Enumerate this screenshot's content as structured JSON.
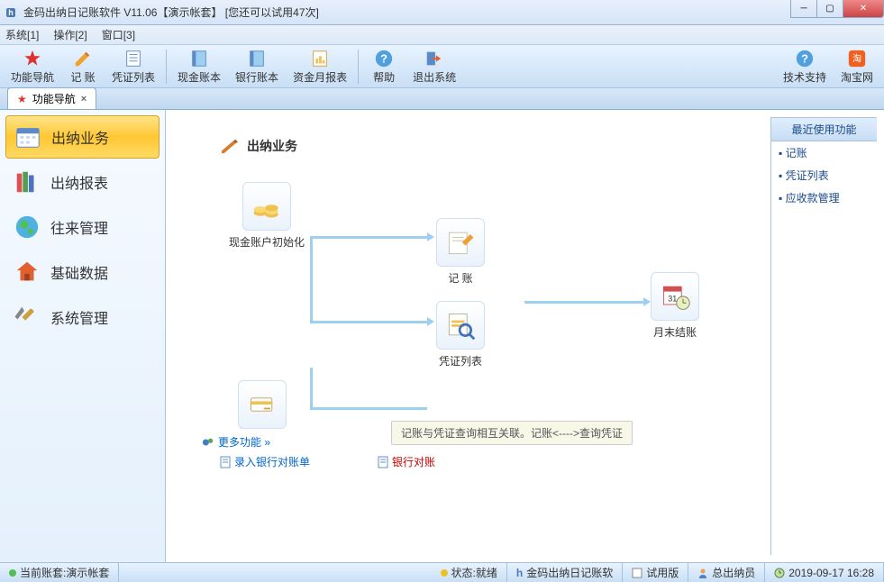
{
  "window": {
    "title": "金码出纳日记账软件  V11.06【演示帐套】  [您还可以试用47次]"
  },
  "menu": {
    "sys": "系统[1]",
    "op": "操作[2]",
    "win": "窗口[3]"
  },
  "toolbar": {
    "nav": "功能导航",
    "entry": "记   账",
    "vouchers": "凭证列表",
    "cashbook": "现金账本",
    "bankbook": "银行账本",
    "monthrep": "资金月报表",
    "help": "帮助",
    "exit": "退出系统",
    "tech": "技术支持",
    "taobao": "淘宝网"
  },
  "tab": {
    "label": "功能导航",
    "icon": "★"
  },
  "sidebar": {
    "items": [
      {
        "label": "出纳业务"
      },
      {
        "label": "出纳报表"
      },
      {
        "label": "往来管理"
      },
      {
        "label": "基础数据"
      },
      {
        "label": "系统管理"
      }
    ]
  },
  "workflow": {
    "title": "出纳业务",
    "init_cash": "现金账户初始化",
    "entry": "记   账",
    "vouchers": "凭证列表",
    "month_close": "月末结账",
    "more": "更多功能 »",
    "import_bank": "录入银行对账单",
    "bank_rec": "银行对账",
    "tooltip": "记账与凭证查询相互关联。记账<---->查询凭证"
  },
  "recent": {
    "header": "最近使用功能",
    "items": [
      "记账",
      "凭证列表",
      "应收款管理"
    ]
  },
  "status": {
    "account": "当前账套:演示帐套",
    "state": "状态:就绪",
    "app": "金码出纳日记账软",
    "trial": "试用版",
    "user": "总出纳员",
    "time": "2019-09-17 16:28"
  }
}
